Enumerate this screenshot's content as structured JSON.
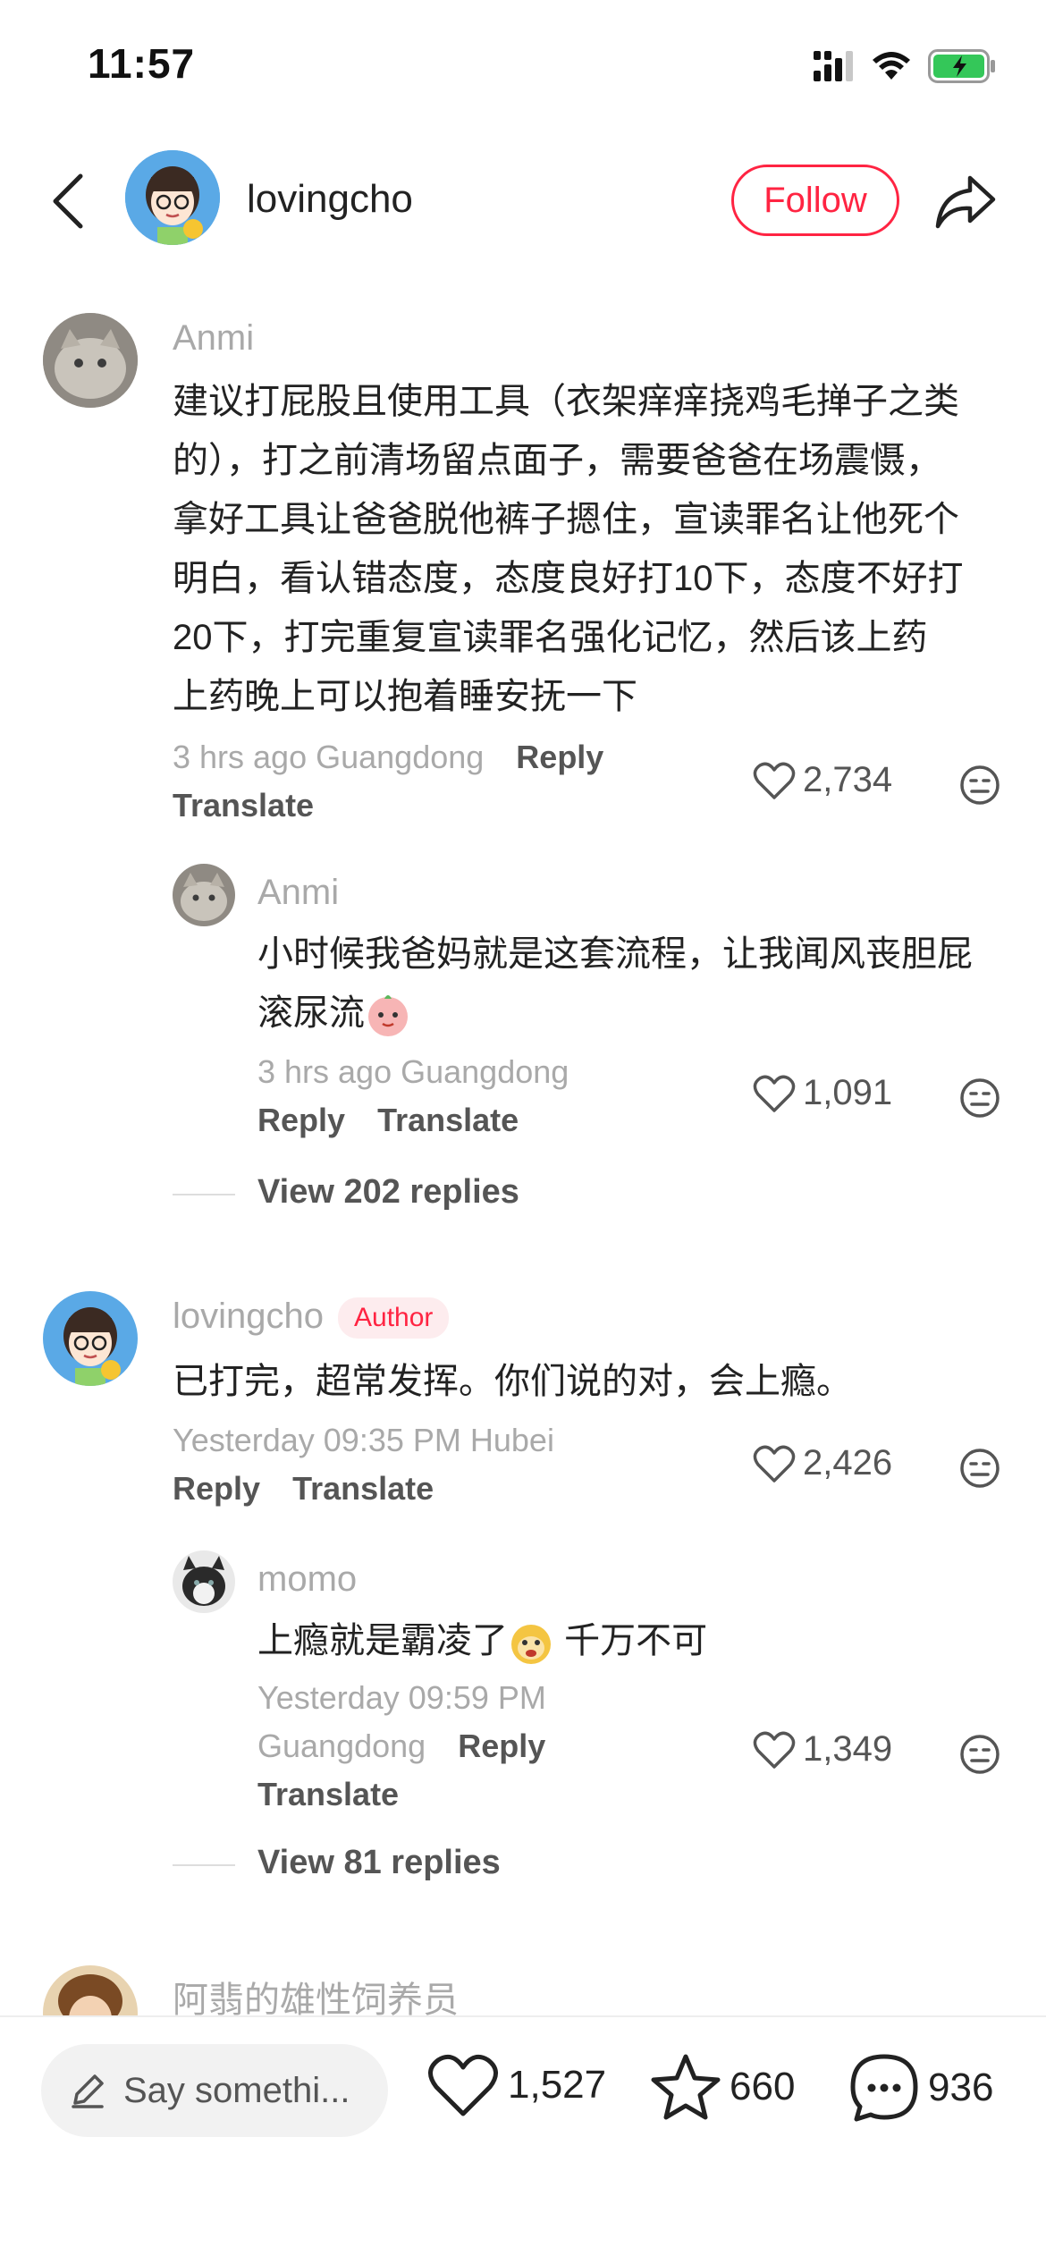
{
  "status_bar": {
    "time": "11:57"
  },
  "header": {
    "username": "lovingcho",
    "follow_label": "Follow"
  },
  "comments": [
    {
      "name": "Anmi",
      "lines": [
        "建议打屁股且使用工具（衣架痒痒挠鸡毛掸子之类",
        "的），打之前清场留点面子，需要爸爸在场震慑，",
        "拿好工具让爸爸脱他裤子摁住，宣读罪名让他死个",
        "明白，看认错态度，态度良好打10下，态度不好打",
        " 20下，打完重复宣读罪名强化记忆，然后该上药",
        "上药晚上可以抱着睡安抚一下"
      ],
      "meta_time": "3 hrs ago Guangdong",
      "reply": "Reply",
      "translate": "Translate",
      "likes": "2,734"
    },
    {
      "name": "Anmi",
      "line1": "小时候我爸妈就是这套流程，让我闻风丧胆屁",
      "line2": "滚尿流",
      "meta_time": "3 hrs ago Guangdong",
      "reply": "Reply",
      "translate": "Translate",
      "likes": "1,091",
      "view_replies": "View 202 replies"
    },
    {
      "name": "lovingcho",
      "badge": "Author",
      "text": "已打完，超常发挥。你们说的对，会上瘾。",
      "meta_time": "Yesterday 09:35 PM Hubei",
      "reply": "Reply",
      "translate": "Translate",
      "likes": "2,426"
    },
    {
      "name": "momo",
      "text_before": "上瘾就是霸凌了",
      "text_after": " 千万不可",
      "meta_time1": "Yesterday 09:59 PM",
      "meta_time2": "Guangdong",
      "reply": "Reply",
      "translate": "Translate",
      "likes": "1,349",
      "view_replies": "View 81 replies"
    },
    {
      "name": "阿翡的雄性饲养员"
    }
  ],
  "bottom_bar": {
    "placeholder": "Say somethi...",
    "likes": "1,527",
    "favorites": "660",
    "comments": "936"
  }
}
